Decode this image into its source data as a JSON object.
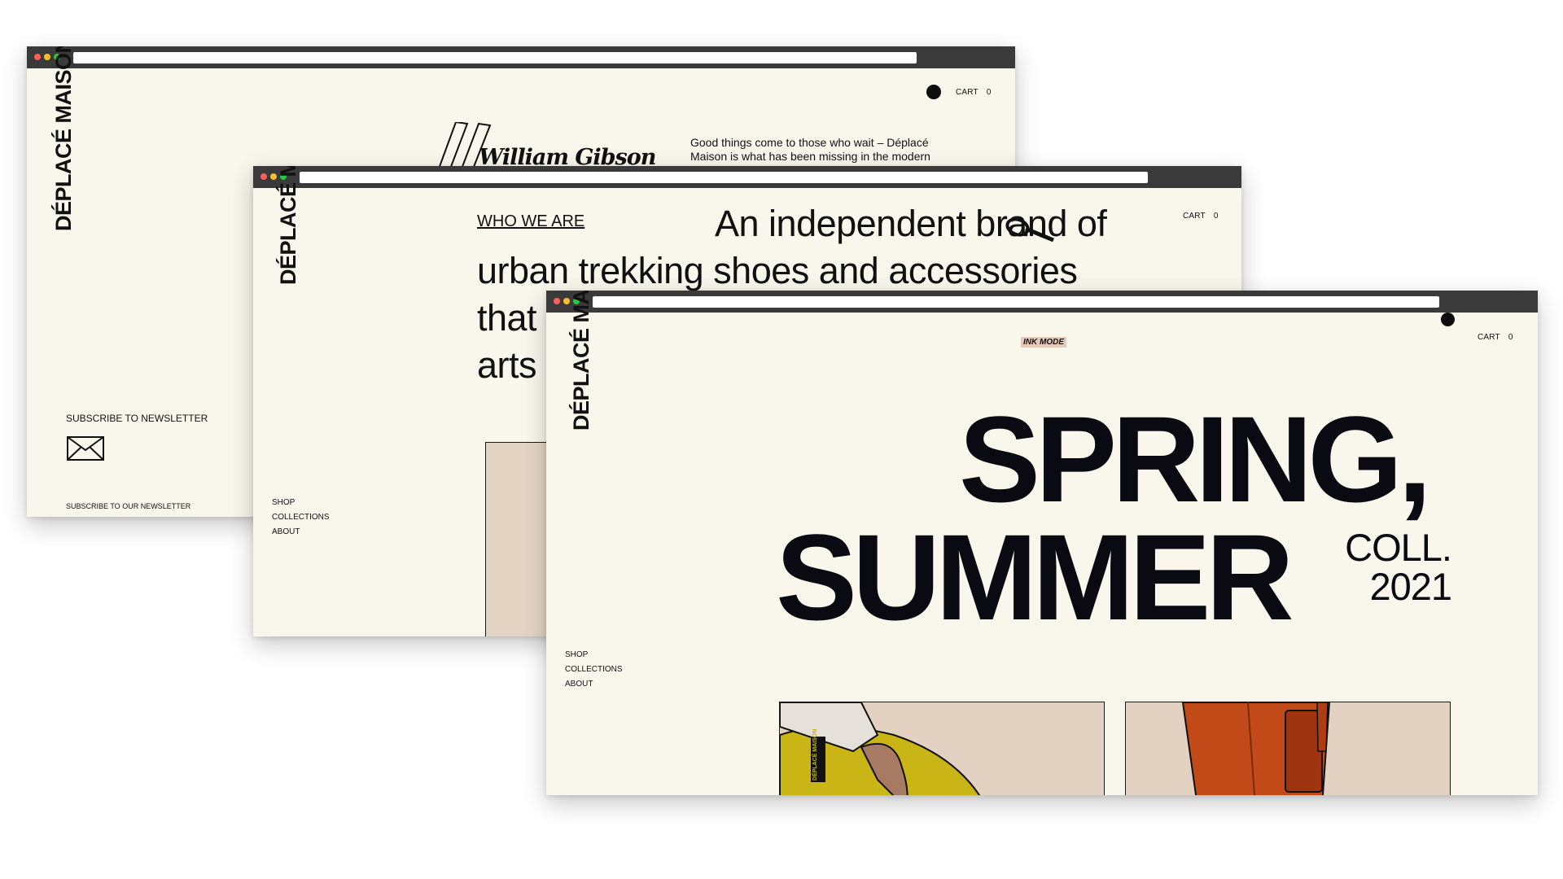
{
  "brand": "DÉPLACÉ MAISON",
  "colors": {
    "page_bg": "#f9f6ec",
    "chrome": "#3a3a3a",
    "ink": "#0a0a12",
    "card_bg": "#e3d2c2",
    "yellow": "#c9b516",
    "orange": "#c24a18"
  },
  "window1": {
    "signature": "William Gibson",
    "quote": "Good things come to those who wait – Déplacé Maison is what has been missing in the modern",
    "cart": {
      "label": "CART",
      "count": "0"
    },
    "newsletter": {
      "title": "SUBSCRIBE TO NEWSLETTER",
      "subtitle": "SUBSCRIBE TO OUR NEWSLETTER",
      "icon": "envelope-icon"
    }
  },
  "window2": {
    "section_link": "WHO WE ARE",
    "headline_line1": "An independent brand of",
    "headline_line2": "urban trekking shoes and accessories",
    "headline_line3": "that",
    "headline_line4": "arts",
    "cart": {
      "label": "CART",
      "count": "0"
    },
    "nav": [
      "SHOP",
      "COLLECTIONS",
      "ABOUT"
    ]
  },
  "window3": {
    "badge": "INK MODE",
    "cart": {
      "label": "CART",
      "count": "0"
    },
    "hero_line1": "SPRING,",
    "hero_line2": "SUMMER",
    "coll_label": "COLL.",
    "coll_year": "2021",
    "nav": [
      "SHOP",
      "COLLECTIONS",
      "ABOUT"
    ],
    "bag_label": "DÉPLACÉ MAISON"
  }
}
